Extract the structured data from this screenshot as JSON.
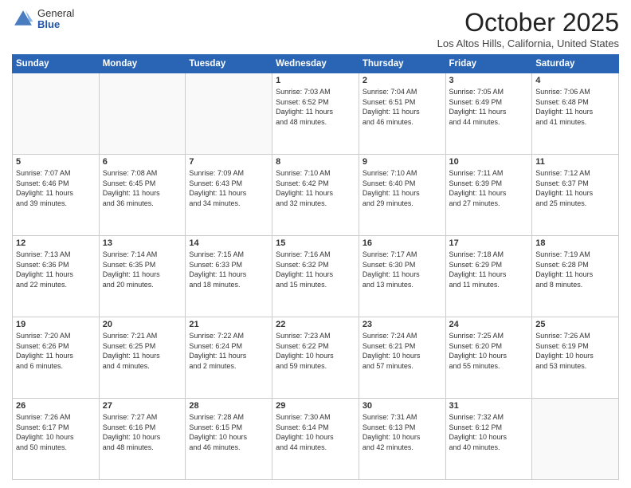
{
  "header": {
    "logo_general": "General",
    "logo_blue": "Blue",
    "title": "October 2025",
    "location": "Los Altos Hills, California, United States"
  },
  "days_of_week": [
    "Sunday",
    "Monday",
    "Tuesday",
    "Wednesday",
    "Thursday",
    "Friday",
    "Saturday"
  ],
  "weeks": [
    [
      {
        "day": "",
        "info": ""
      },
      {
        "day": "",
        "info": ""
      },
      {
        "day": "",
        "info": ""
      },
      {
        "day": "1",
        "info": "Sunrise: 7:03 AM\nSunset: 6:52 PM\nDaylight: 11 hours\nand 48 minutes."
      },
      {
        "day": "2",
        "info": "Sunrise: 7:04 AM\nSunset: 6:51 PM\nDaylight: 11 hours\nand 46 minutes."
      },
      {
        "day": "3",
        "info": "Sunrise: 7:05 AM\nSunset: 6:49 PM\nDaylight: 11 hours\nand 44 minutes."
      },
      {
        "day": "4",
        "info": "Sunrise: 7:06 AM\nSunset: 6:48 PM\nDaylight: 11 hours\nand 41 minutes."
      }
    ],
    [
      {
        "day": "5",
        "info": "Sunrise: 7:07 AM\nSunset: 6:46 PM\nDaylight: 11 hours\nand 39 minutes."
      },
      {
        "day": "6",
        "info": "Sunrise: 7:08 AM\nSunset: 6:45 PM\nDaylight: 11 hours\nand 36 minutes."
      },
      {
        "day": "7",
        "info": "Sunrise: 7:09 AM\nSunset: 6:43 PM\nDaylight: 11 hours\nand 34 minutes."
      },
      {
        "day": "8",
        "info": "Sunrise: 7:10 AM\nSunset: 6:42 PM\nDaylight: 11 hours\nand 32 minutes."
      },
      {
        "day": "9",
        "info": "Sunrise: 7:10 AM\nSunset: 6:40 PM\nDaylight: 11 hours\nand 29 minutes."
      },
      {
        "day": "10",
        "info": "Sunrise: 7:11 AM\nSunset: 6:39 PM\nDaylight: 11 hours\nand 27 minutes."
      },
      {
        "day": "11",
        "info": "Sunrise: 7:12 AM\nSunset: 6:37 PM\nDaylight: 11 hours\nand 25 minutes."
      }
    ],
    [
      {
        "day": "12",
        "info": "Sunrise: 7:13 AM\nSunset: 6:36 PM\nDaylight: 11 hours\nand 22 minutes."
      },
      {
        "day": "13",
        "info": "Sunrise: 7:14 AM\nSunset: 6:35 PM\nDaylight: 11 hours\nand 20 minutes."
      },
      {
        "day": "14",
        "info": "Sunrise: 7:15 AM\nSunset: 6:33 PM\nDaylight: 11 hours\nand 18 minutes."
      },
      {
        "day": "15",
        "info": "Sunrise: 7:16 AM\nSunset: 6:32 PM\nDaylight: 11 hours\nand 15 minutes."
      },
      {
        "day": "16",
        "info": "Sunrise: 7:17 AM\nSunset: 6:30 PM\nDaylight: 11 hours\nand 13 minutes."
      },
      {
        "day": "17",
        "info": "Sunrise: 7:18 AM\nSunset: 6:29 PM\nDaylight: 11 hours\nand 11 minutes."
      },
      {
        "day": "18",
        "info": "Sunrise: 7:19 AM\nSunset: 6:28 PM\nDaylight: 11 hours\nand 8 minutes."
      }
    ],
    [
      {
        "day": "19",
        "info": "Sunrise: 7:20 AM\nSunset: 6:26 PM\nDaylight: 11 hours\nand 6 minutes."
      },
      {
        "day": "20",
        "info": "Sunrise: 7:21 AM\nSunset: 6:25 PM\nDaylight: 11 hours\nand 4 minutes."
      },
      {
        "day": "21",
        "info": "Sunrise: 7:22 AM\nSunset: 6:24 PM\nDaylight: 11 hours\nand 2 minutes."
      },
      {
        "day": "22",
        "info": "Sunrise: 7:23 AM\nSunset: 6:22 PM\nDaylight: 10 hours\nand 59 minutes."
      },
      {
        "day": "23",
        "info": "Sunrise: 7:24 AM\nSunset: 6:21 PM\nDaylight: 10 hours\nand 57 minutes."
      },
      {
        "day": "24",
        "info": "Sunrise: 7:25 AM\nSunset: 6:20 PM\nDaylight: 10 hours\nand 55 minutes."
      },
      {
        "day": "25",
        "info": "Sunrise: 7:26 AM\nSunset: 6:19 PM\nDaylight: 10 hours\nand 53 minutes."
      }
    ],
    [
      {
        "day": "26",
        "info": "Sunrise: 7:26 AM\nSunset: 6:17 PM\nDaylight: 10 hours\nand 50 minutes."
      },
      {
        "day": "27",
        "info": "Sunrise: 7:27 AM\nSunset: 6:16 PM\nDaylight: 10 hours\nand 48 minutes."
      },
      {
        "day": "28",
        "info": "Sunrise: 7:28 AM\nSunset: 6:15 PM\nDaylight: 10 hours\nand 46 minutes."
      },
      {
        "day": "29",
        "info": "Sunrise: 7:30 AM\nSunset: 6:14 PM\nDaylight: 10 hours\nand 44 minutes."
      },
      {
        "day": "30",
        "info": "Sunrise: 7:31 AM\nSunset: 6:13 PM\nDaylight: 10 hours\nand 42 minutes."
      },
      {
        "day": "31",
        "info": "Sunrise: 7:32 AM\nSunset: 6:12 PM\nDaylight: 10 hours\nand 40 minutes."
      },
      {
        "day": "",
        "info": ""
      }
    ]
  ]
}
